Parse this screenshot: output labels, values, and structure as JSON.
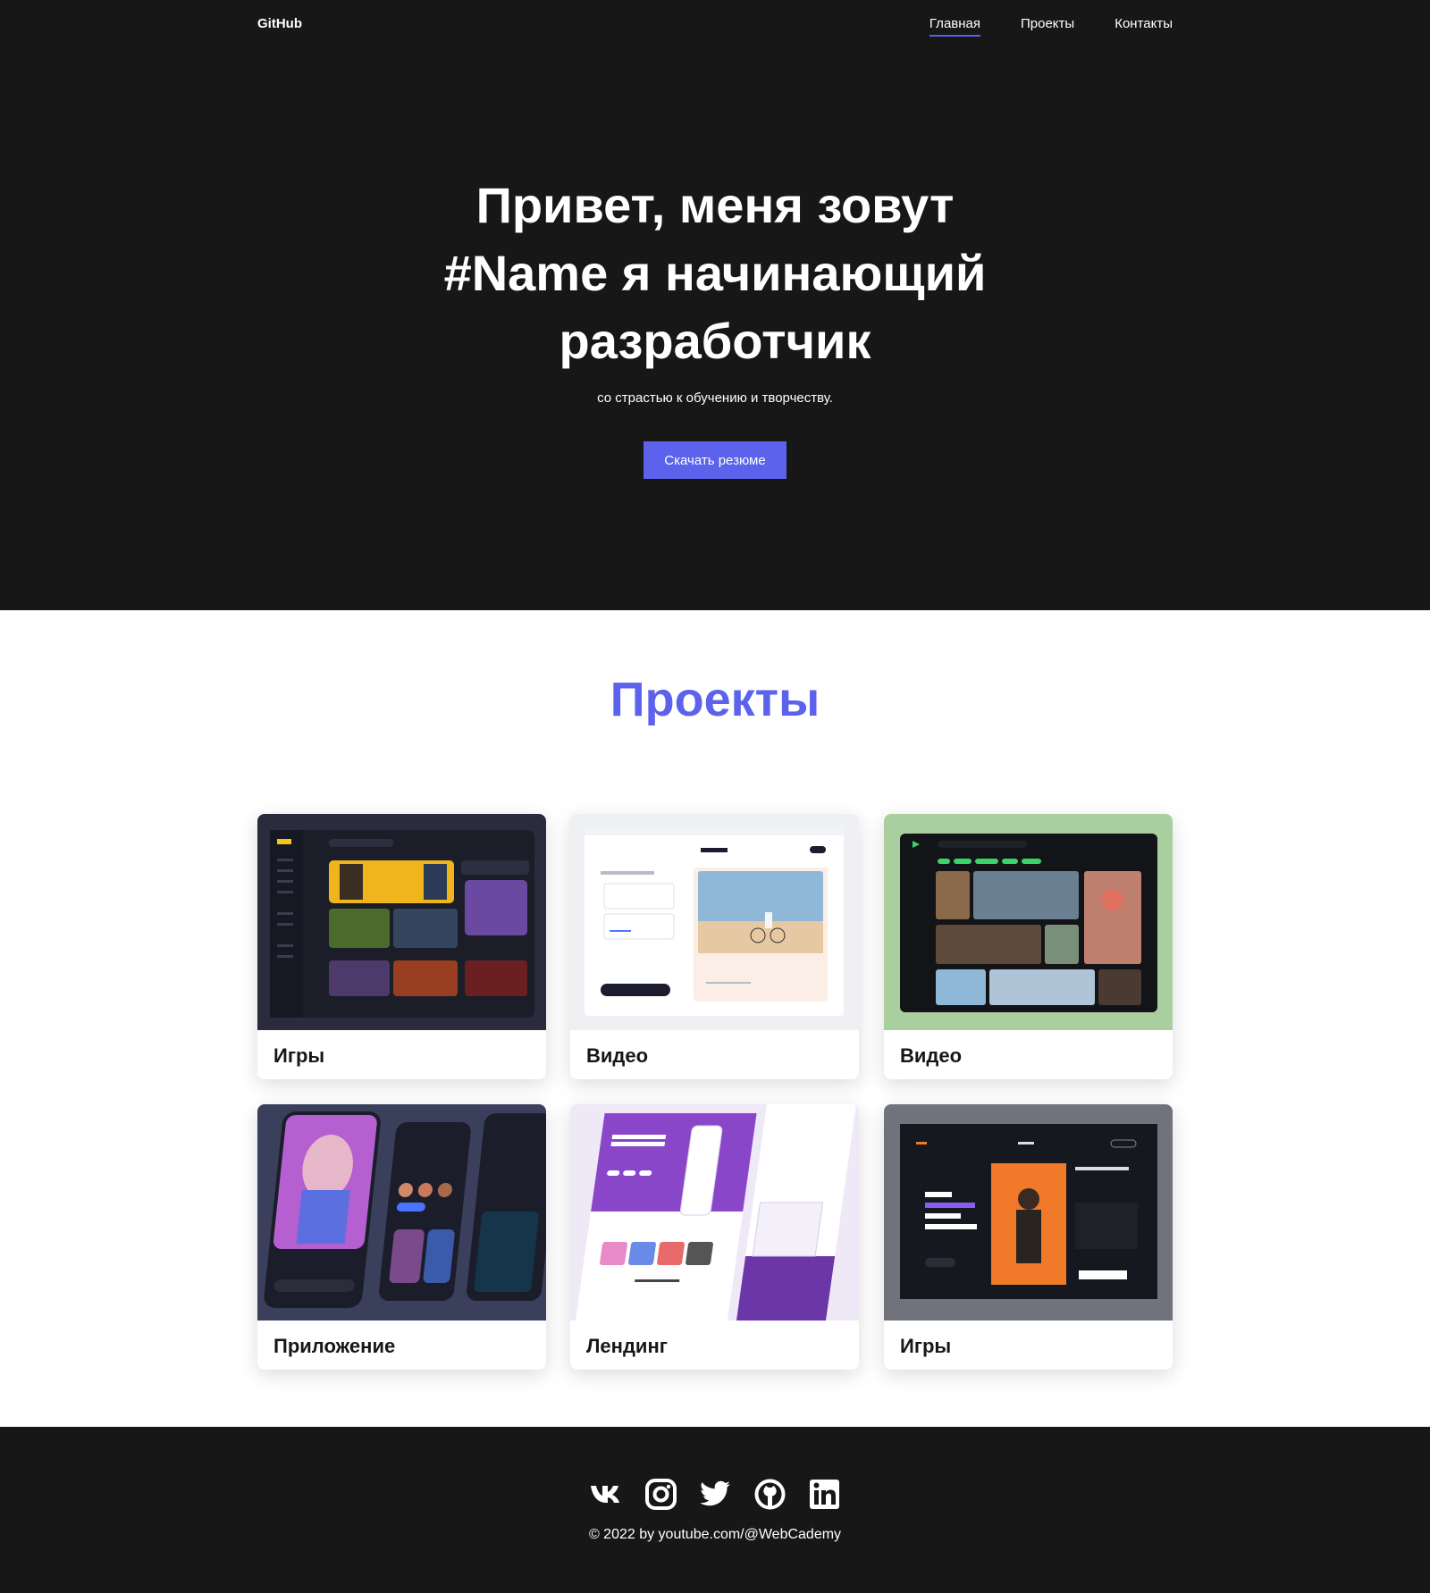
{
  "nav": {
    "logo": "GitHub",
    "items": [
      "Главная",
      "Проекты",
      "Контакты"
    ]
  },
  "hero": {
    "title_line1": "Привет, меня зовут",
    "title_name": "#Name",
    "title_line2": " я начинающий",
    "title_line3": "разработчик",
    "subtitle": "со страстью к обучению и творчеству.",
    "button": "Скачать резюме"
  },
  "projects": {
    "title": "Проекты",
    "cards": [
      {
        "title": "Игры"
      },
      {
        "title": "Видео"
      },
      {
        "title": "Видео"
      },
      {
        "title": "Приложение"
      },
      {
        "title": "Лендинг"
      },
      {
        "title": "Игры"
      }
    ]
  },
  "footer": {
    "social": [
      "vk-icon",
      "instagram-icon",
      "twitter-icon",
      "github-icon",
      "linkedin-icon"
    ],
    "copyright": "© 2022 by youtube.com/@WebCademy"
  },
  "colors": {
    "dark": "#171718",
    "accent": "#5c62ec"
  }
}
